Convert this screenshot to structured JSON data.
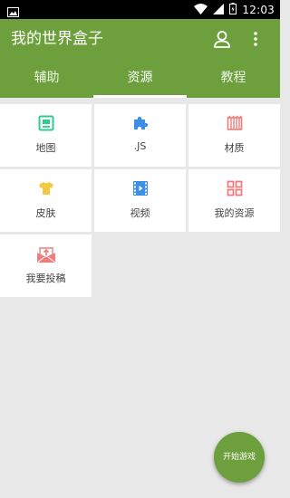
{
  "status_bar": {
    "time": "12:03"
  },
  "app_bar": {
    "title": "我的世界盒子"
  },
  "tabs": [
    {
      "label": "辅助",
      "active": false
    },
    {
      "label": "资源",
      "active": true
    },
    {
      "label": "教程",
      "active": false
    }
  ],
  "grid_items": [
    {
      "label": "地图",
      "icon": "map-icon",
      "color": "#2ecc8f"
    },
    {
      "label": ".JS",
      "icon": "puzzle-icon",
      "color": "#3a8ee6"
    },
    {
      "label": "材质",
      "icon": "texture-icon",
      "color": "#f07c7c"
    },
    {
      "label": "皮肤",
      "icon": "tshirt-icon",
      "color": "#f5c842"
    },
    {
      "label": "视频",
      "icon": "film-icon",
      "color": "#3a8ee6"
    },
    {
      "label": "我的资源",
      "icon": "grid-icon",
      "color": "#f07c7c"
    },
    {
      "label": "我要投稿",
      "icon": "mail-upload-icon",
      "color": "#f07c7c"
    }
  ],
  "fab": {
    "label": "开始游戏"
  },
  "colors": {
    "primary": "#6d9f3c",
    "background": "#e8e8e8"
  }
}
